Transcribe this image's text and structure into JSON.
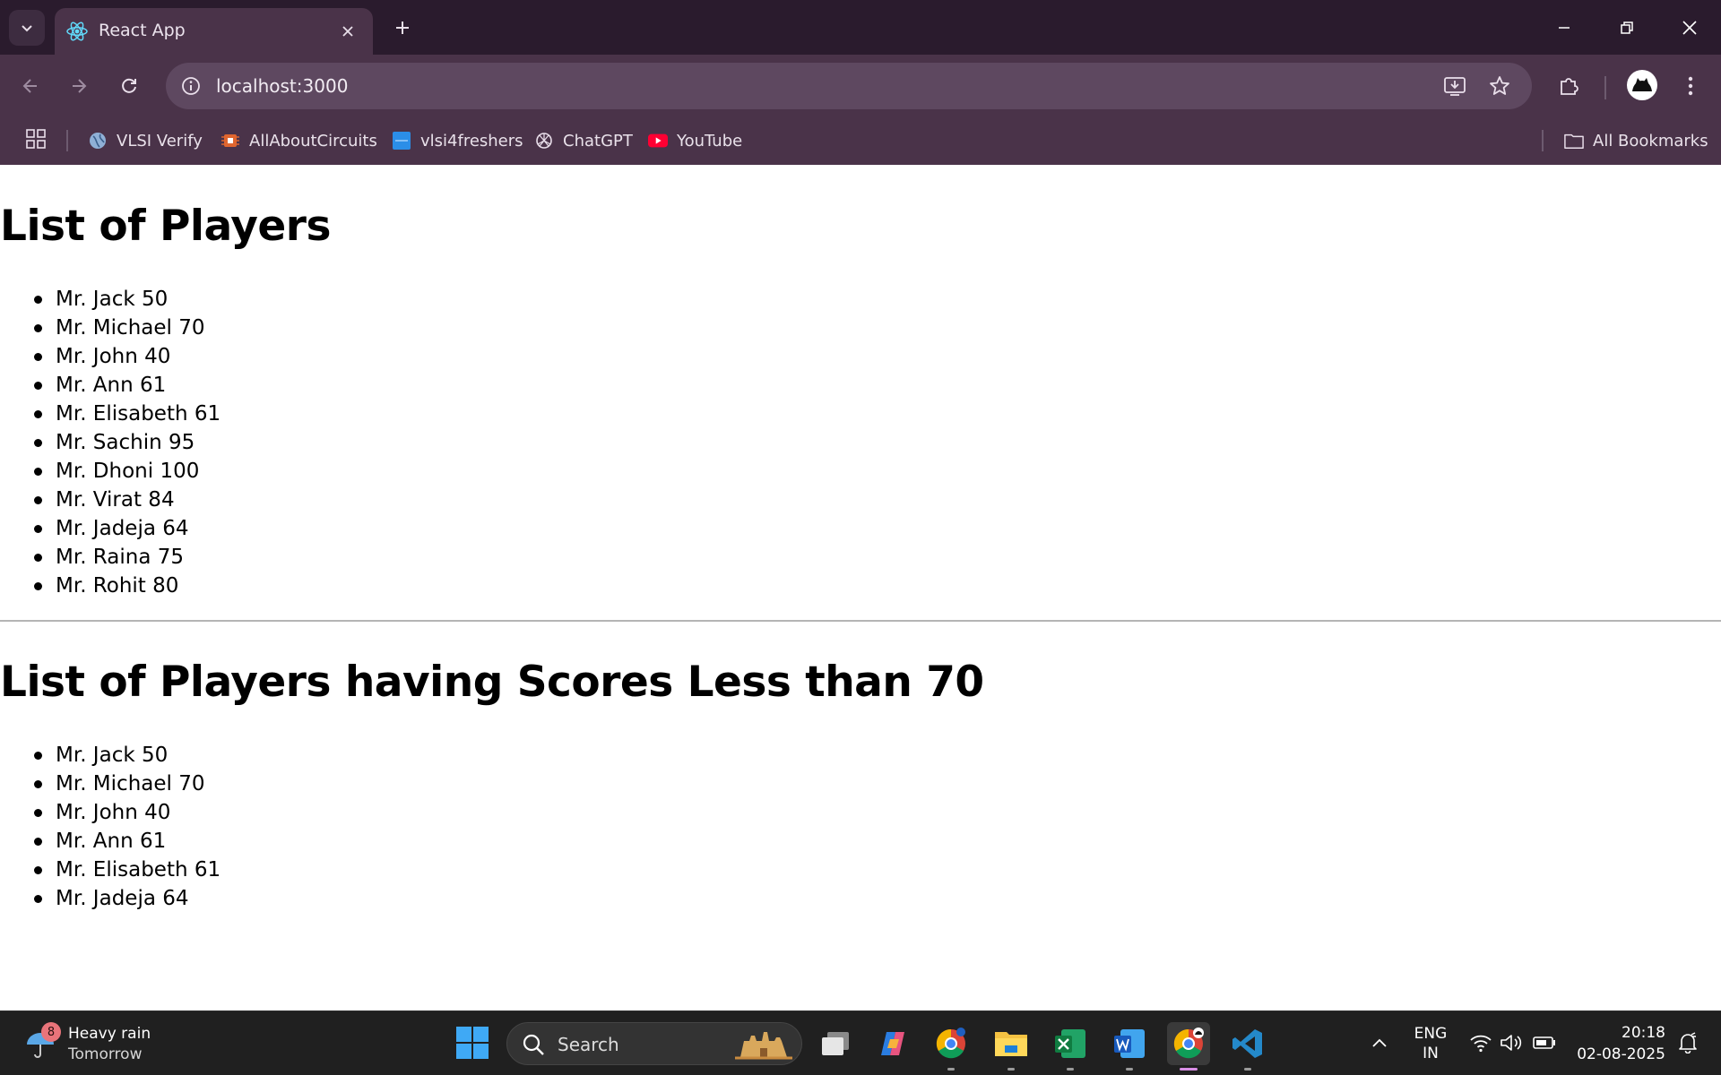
{
  "browser": {
    "tab": {
      "title": "React App"
    },
    "url": "localhost:3000",
    "bookmarks": [
      {
        "label": "VLSI Verify",
        "icon": "globe-icon"
      },
      {
        "label": "AllAboutCircuits",
        "icon": "chip-icon"
      },
      {
        "label": "vlsi4freshers",
        "icon": "blue-square-icon"
      },
      {
        "label": "ChatGPT",
        "icon": "openai-icon"
      },
      {
        "label": "YouTube",
        "icon": "youtube-icon"
      }
    ],
    "all_bookmarks_label": "All Bookmarks"
  },
  "page": {
    "heading_all": "List of Players",
    "players_all": [
      "Mr. Jack 50",
      "Mr. Michael 70",
      "Mr. John 40",
      "Mr. Ann 61",
      "Mr. Elisabeth 61",
      "Mr. Sachin 95",
      "Mr. Dhoni 100",
      "Mr. Virat 84",
      "Mr. Jadeja 64",
      "Mr. Raina 75",
      "Mr. Rohit 80"
    ],
    "heading_filtered": "List of Players having Scores Less than 70",
    "players_filtered": [
      "Mr. Jack 50",
      "Mr. Michael 70",
      "Mr. John 40",
      "Mr. Ann 61",
      "Mr. Elisabeth 61",
      "Mr. Jadeja 64"
    ]
  },
  "taskbar": {
    "weather": {
      "badge": "8",
      "line1": "Heavy rain",
      "line2": "Tomorrow"
    },
    "search_label": "Search",
    "lang_line1": "ENG",
    "lang_line2": "IN",
    "time": "20:18",
    "date": "02-08-2025"
  },
  "colors": {
    "tabstrip_bg": "#2a1b2d",
    "toolbar_bg": "#4a3349",
    "omnibox_bg": "#5e4860",
    "taskbar_bg": "#202020"
  }
}
